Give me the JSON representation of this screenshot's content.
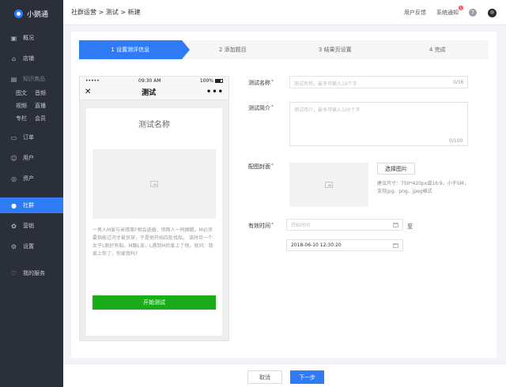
{
  "brand": {
    "name": "小鹅通"
  },
  "sidebar": {
    "items": [
      {
        "label": "概况",
        "icon": "overview-icon"
      },
      {
        "label": "店铺",
        "icon": "store-icon"
      },
      {
        "label": "知识商品",
        "icon": "knowledge-goods-icon"
      },
      {
        "label": "订单",
        "icon": "order-icon"
      },
      {
        "label": "用户",
        "icon": "user-icon"
      },
      {
        "label": "资产",
        "icon": "asset-icon"
      },
      {
        "label": "社群",
        "icon": "community-icon"
      },
      {
        "label": "营销",
        "icon": "marketing-icon"
      },
      {
        "label": "设置",
        "icon": "settings-icon"
      },
      {
        "label": "我的服务",
        "icon": "heart-icon"
      }
    ],
    "sub_items": [
      {
        "label": "图文"
      },
      {
        "label": "音频"
      },
      {
        "label": "视频"
      },
      {
        "label": "直播"
      },
      {
        "label": "专栏"
      },
      {
        "label": "会员"
      }
    ],
    "active_color": "#2f7bf5"
  },
  "header": {
    "breadcrumb": "社群运营 > 测试 > 新建",
    "feedback": "用户反馈",
    "notice": "系统通知",
    "notice_badge": "5",
    "help": "?"
  },
  "stepper": {
    "steps": [
      {
        "label": "1  设置测评信息"
      },
      {
        "label": "2  添加题目"
      },
      {
        "label": "3  结果页设置"
      },
      {
        "label": "4  完成"
      }
    ],
    "active_index": 0
  },
  "phone": {
    "signal": "•••••",
    "time": "09:30 AM",
    "battery": "100%",
    "title": "测试",
    "close": "✕",
    "more": "•••",
    "preview_title": "测试名称",
    "desc": "一男人M爱与米错事F相会选婚，但两人一同捆踢。M必须要指能过河才被员穿，于是他开始四处找船。 该时另一个女子L刚好有船。M跟L谈，L遇到M后爱上了他。就问：我爱上你了，你爱我吗?",
    "start_button": "开始测试",
    "start_color": "#1aad19"
  },
  "form": {
    "name_label": "测试名称",
    "name_placeholder": "测试名称，最多可输入16个字",
    "name_counter": "0/16",
    "intro_label": "测试简介",
    "intro_placeholder": "测试简介，最多可输入100个字",
    "intro_counter": "0/100",
    "cover_label": "配图封面",
    "choose_image": "选择图片",
    "cover_hint": "建议尺寸：750*420px或16:9，小于5M，支持jpg、png、jpeg格式",
    "valid_label": "有效时间",
    "start_placeholder": "开始时间",
    "to_label": "至",
    "end_value": "2018-06-10 12:30:20"
  },
  "footer": {
    "cancel": "取消",
    "next": "下一步"
  }
}
